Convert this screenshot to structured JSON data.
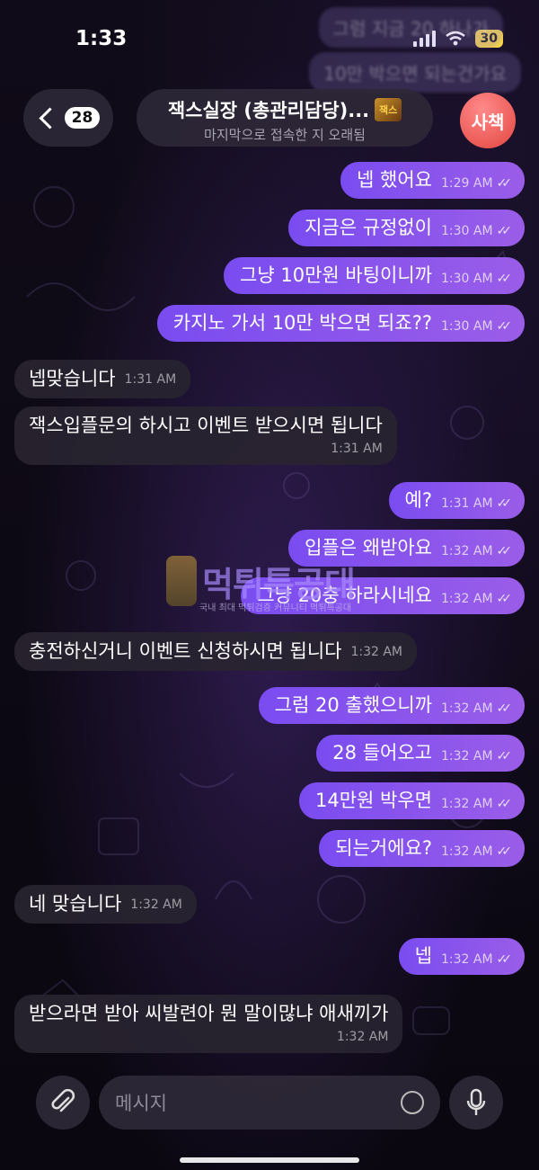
{
  "status": {
    "time": "1:33",
    "battery": "30"
  },
  "ghost_messages": [
    {
      "text": "그럼 지금 20 하나가"
    },
    {
      "text": "10만 박으면 되는건가요"
    }
  ],
  "header": {
    "back_count": "28",
    "title": "잭스실장 (총관리담당)...",
    "logo_text": "잭스",
    "subtitle": "마지막으로 접속한 지 오래됨",
    "avatar_text": "사책"
  },
  "messages": [
    {
      "dir": "out",
      "text": "넵 했어요",
      "time": "1:29 AM"
    },
    {
      "dir": "out",
      "text": "지금은 규정없이",
      "time": "1:30 AM"
    },
    {
      "dir": "out",
      "text": "그냥 10만원 바팅이니까",
      "time": "1:30 AM"
    },
    {
      "dir": "out",
      "text": "카지노 가서 10만 박으면 되죠??",
      "time": "1:30 AM"
    },
    {
      "dir": "in",
      "text": "넵맞습니다",
      "time": "1:31 AM"
    },
    {
      "dir": "in",
      "text": "잭스입플문의 하시고 이벤트 받으시면 됩니다",
      "time": "1:31 AM"
    },
    {
      "dir": "out",
      "text": "예?",
      "time": "1:31 AM"
    },
    {
      "dir": "out",
      "text": "입플은 왜받아요",
      "time": "1:32 AM"
    },
    {
      "dir": "out",
      "text": "그냥 20충 하라시네요",
      "time": "1:32 AM"
    },
    {
      "dir": "in",
      "text": "충전하신거니 이벤트 신청하시면 됩니다",
      "time": "1:32 AM"
    },
    {
      "dir": "out",
      "text": "그럼 20 출했으니까",
      "time": "1:32 AM"
    },
    {
      "dir": "out",
      "text": "28 들어오고",
      "time": "1:32 AM"
    },
    {
      "dir": "out",
      "text": "14만원 박우면",
      "time": "1:32 AM"
    },
    {
      "dir": "out",
      "text": "되는거에요?",
      "time": "1:32 AM"
    },
    {
      "dir": "in",
      "text": "네 맞습니다",
      "time": "1:32 AM"
    },
    {
      "dir": "out",
      "text": "넵",
      "time": "1:32 AM"
    },
    {
      "dir": "in",
      "text": "받으라면 받아 씨발련아 뭔 말이많냐 애새끼가",
      "time": "1:32 AM"
    }
  ],
  "watermark": {
    "title": "먹튀특공대",
    "subtitle": "국내 최대 먹튀검증 커뮤니티 먹튀특공대"
  },
  "input": {
    "placeholder": "메시지"
  },
  "colors": {
    "outgoing": "#8a55ee",
    "incoming": "#28242f",
    "avatar": "#e2463f",
    "battery": "#f5d34a"
  }
}
